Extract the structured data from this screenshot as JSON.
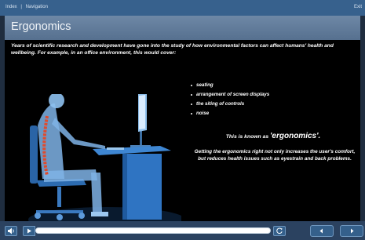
{
  "top_bar": {
    "nav_items": [
      "Index",
      "Navigation"
    ],
    "separator": "|",
    "exit_label": "Exit"
  },
  "page": {
    "title": "Ergonomics",
    "intro": "Years of scientific research and development have gone into the study of how environmental factors can affect humans' health and wellbeing. For example, in an office environment, this would cover:",
    "bullets": [
      "seating",
      "arrangement of screen displays",
      "the siting of controls",
      "noise"
    ],
    "known_prefix": "This is known as",
    "known_term": "'ergonomics'.",
    "getting_text": "Getting the ergonomics right not only increases the user's comfort, but reduces health issues such as eyestrain and back problems."
  },
  "controls": {
    "progress": 1.0,
    "icons": {
      "audio": "speaker-icon",
      "play": "play-icon",
      "replay": "replay-icon",
      "prev": "chevron-left-icon",
      "next": "chevron-right-icon"
    }
  },
  "colors": {
    "top_bar": "#37618d",
    "title_bar": "#6e88a6",
    "content_bg": "#000000",
    "controls_bg": "#2b4260",
    "spine": "#e04a2c"
  }
}
